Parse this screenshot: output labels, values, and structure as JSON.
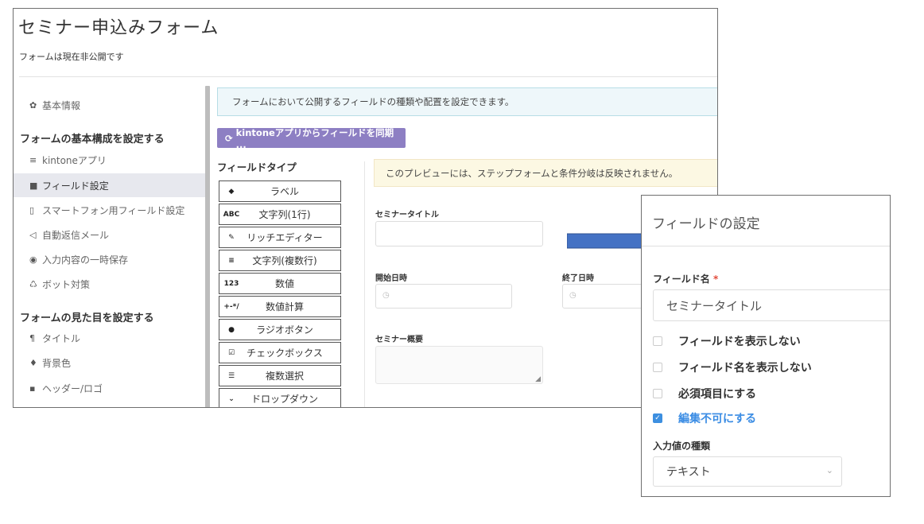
{
  "form": {
    "title": "セミナー申込みフォーム",
    "status": "フォームは現在非公開です"
  },
  "sidebar": {
    "basic_info": "基本情報",
    "section1": "フォームの基本構成を設定する",
    "items1": [
      {
        "icon": "database-icon",
        "label": "kintoneアプリ"
      },
      {
        "icon": "grid-icon",
        "label": "フィールド設定"
      },
      {
        "icon": "smartphone-icon",
        "label": "スマートフォン用フィールド設定"
      },
      {
        "icon": "send-icon",
        "label": "自動返信メール"
      },
      {
        "icon": "save-icon",
        "label": "入力内容の一時保存"
      },
      {
        "icon": "recycle-icon",
        "label": "ボット対策"
      }
    ],
    "section2": "フォームの見た目を設定する",
    "items2": [
      {
        "icon": "paragraph-icon",
        "label": "タイトル"
      },
      {
        "icon": "drop-icon",
        "label": "背景色"
      },
      {
        "icon": "image-icon",
        "label": "ヘッダー/ロゴ"
      }
    ]
  },
  "main": {
    "info": "フォームにおいて公開するフィールドの種類や配置を設定できます。",
    "sync_button": "kintoneアプリからフィールドを同期 ...",
    "field_type_label": "フィールドタイプ",
    "field_types": [
      {
        "icon": "◆",
        "label": "ラベル"
      },
      {
        "icon": "ABC",
        "label": "文字列(1行)"
      },
      {
        "icon": "✎",
        "label": "リッチエディター"
      },
      {
        "icon": "≡",
        "label": "文字列(複数行)"
      },
      {
        "icon": "123",
        "label": "数値"
      },
      {
        "icon": "+-*/",
        "label": "数値計算"
      },
      {
        "icon": "●",
        "label": "ラジオボタン"
      },
      {
        "icon": "☑",
        "label": "チェックボックス"
      },
      {
        "icon": "☰",
        "label": "複数選択"
      },
      {
        "icon": "⌄",
        "label": "ドロップダウン"
      }
    ],
    "preview_warning": "このプレビューには、ステップフォームと条件分岐は反映されません。",
    "preview_fields": {
      "seminar_title": "セミナータイトル",
      "start_date": "開始日時",
      "end_date": "終了日時",
      "seminar_summary": "セミナー概要"
    }
  },
  "panel": {
    "title": "フィールドの設定",
    "field_name_label": "フィールド名",
    "required_mark": "*",
    "field_name_value": "セミナータイトル",
    "options": [
      {
        "label": "フィールドを表示しない",
        "checked": false
      },
      {
        "label": "フィールド名を表示しない",
        "checked": false
      },
      {
        "label": "必須項目にする",
        "checked": false
      },
      {
        "label": "編集不可にする",
        "checked": true
      }
    ],
    "input_type_label": "入力値の種類",
    "input_type_value": "テキスト"
  },
  "colors": {
    "accent": "#8d7fc3",
    "arrow": "#4472c4",
    "checked": "#3d8fe0"
  }
}
